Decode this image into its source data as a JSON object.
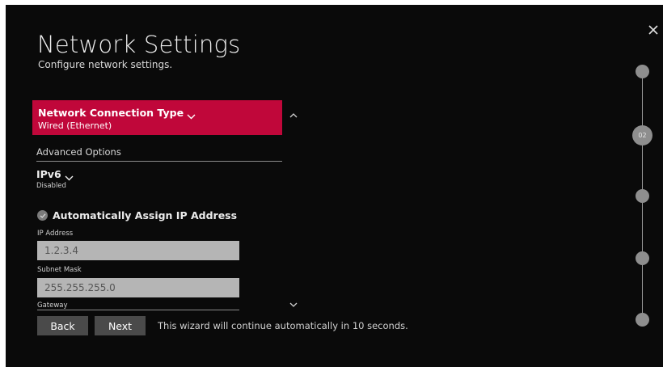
{
  "header": {
    "title": "Network Settings",
    "subtitle": "Configure network settings.",
    "close_icon": "close-icon"
  },
  "connection_type": {
    "label": "Network Connection Type",
    "value": "Wired (Ethernet)"
  },
  "advanced": {
    "label": "Advanced Options"
  },
  "ipv6": {
    "label": "IPv6",
    "value": "Disabled"
  },
  "auto_assign": {
    "label": "Automatically Assign IP Address",
    "checked": true
  },
  "fields": {
    "ip_address": {
      "label": "IP Address",
      "value": "1.2.3.4"
    },
    "subnet_mask": {
      "label": "Subnet Mask",
      "value": "255.255.255.0"
    },
    "gateway": {
      "label": "Gateway"
    }
  },
  "footer": {
    "back_label": "Back",
    "next_label": "Next",
    "message": "This wizard will continue automatically in 10 seconds."
  },
  "stepper": {
    "current_step": "02",
    "total_steps": 5
  },
  "colors": {
    "accent": "#c0073a",
    "background": "#0a0a0a",
    "field": "#b5b5b5",
    "button": "#4a4a4a"
  }
}
